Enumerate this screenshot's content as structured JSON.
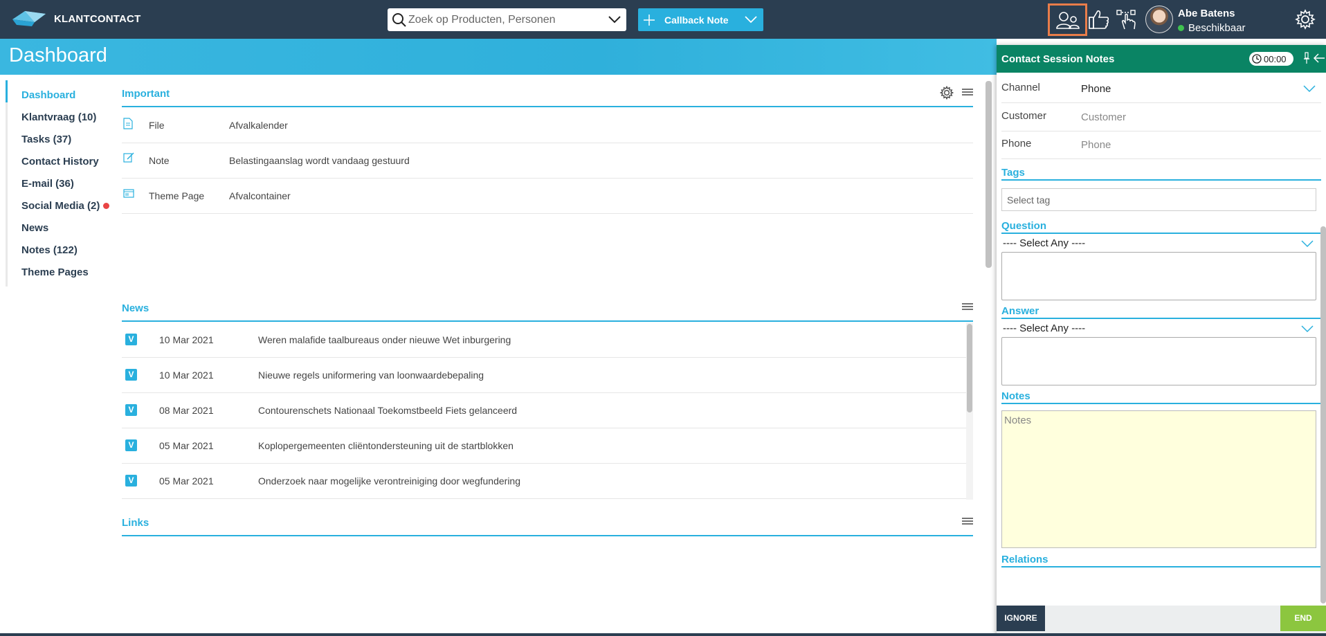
{
  "app": {
    "name": "KLANTCONTACT"
  },
  "search": {
    "placeholder": "Zoek op Producten, Personen"
  },
  "callback": {
    "label": "Callback Note"
  },
  "user": {
    "name": "Abe Batens",
    "status": "Beschikbaar",
    "status_color": "#3fc24f"
  },
  "page": {
    "title": "Dashboard"
  },
  "sidebar": {
    "items": [
      {
        "label": "Dashboard",
        "active": true
      },
      {
        "label": "Klantvraag (10)"
      },
      {
        "label": "Tasks (37)"
      },
      {
        "label": "Contact History"
      },
      {
        "label": "E-mail (36)"
      },
      {
        "label": "Social Media (2)"
      },
      {
        "label": "News"
      },
      {
        "label": "Notes (122)"
      },
      {
        "label": "Theme Pages"
      }
    ]
  },
  "important": {
    "title": "Important",
    "rows": [
      {
        "icon": "file-icon",
        "type": "File",
        "text": "Afvalkalender"
      },
      {
        "icon": "note-icon",
        "type": "Note",
        "text": "Belastingaanslag wordt vandaag gestuurd"
      },
      {
        "icon": "theme-page-icon",
        "type": "Theme Page",
        "text": "Afvalcontainer"
      }
    ]
  },
  "news": {
    "title": "News",
    "badge": "V",
    "items": [
      {
        "date": "10 Mar 2021",
        "title": "Weren malafide taalbureaus onder nieuwe Wet inburgering"
      },
      {
        "date": "10 Mar 2021",
        "title": "Nieuwe regels uniformering van loonwaardebepaling"
      },
      {
        "date": "08 Mar 2021",
        "title": "Contourenschets Nationaal Toekomstbeeld Fiets gelanceerd"
      },
      {
        "date": "05 Mar 2021",
        "title": "Koplopergemeenten cliëntondersteuning uit de startblokken"
      },
      {
        "date": "05 Mar 2021",
        "title": "Onderzoek naar mogelijke verontreiniging door wegfundering"
      }
    ]
  },
  "links": {
    "title": "Links"
  },
  "session_notes": {
    "title": "Contact Session Notes",
    "timer": "00:00",
    "channel": {
      "label": "Channel",
      "value": "Phone"
    },
    "customer": {
      "label": "Customer",
      "placeholder": "Customer"
    },
    "phone": {
      "label": "Phone",
      "placeholder": "Phone"
    },
    "tags": {
      "title": "Tags",
      "placeholder": "Select tag"
    },
    "question": {
      "title": "Question",
      "select": "---- Select Any ----"
    },
    "answer": {
      "title": "Answer",
      "select": "---- Select Any ----"
    },
    "notes": {
      "title": "Notes",
      "placeholder": "Notes",
      "bg_color": "#ffffdd"
    },
    "relations": {
      "title": "Relations"
    },
    "ignore_label": "IGNORE",
    "end_label": "END"
  },
  "colors": {
    "topbar": "#2b3e51",
    "accent": "#29b0de",
    "header_green": "#0a8464",
    "end_green": "#8cc63f",
    "highlight": "#e97d4a"
  }
}
